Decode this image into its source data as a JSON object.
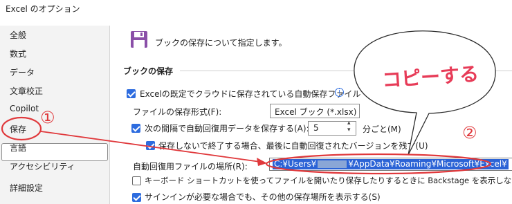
{
  "window": {
    "title": "Excel のオプション"
  },
  "sidebar": {
    "items": [
      {
        "label": "全般"
      },
      {
        "label": "数式"
      },
      {
        "label": "データ"
      },
      {
        "label": "文章校正"
      },
      {
        "label": "Copilot"
      },
      {
        "label": "保存"
      },
      {
        "label": "言語"
      },
      {
        "label": "アクセシビリティ"
      },
      {
        "label": "詳細設定"
      }
    ],
    "selected_index": 5
  },
  "main": {
    "header": "ブックの保存について指定します。",
    "section_title": "ブックの保存",
    "autosave_default": {
      "label": "Excelの既定でクラウドに保存されている自動保存ファイル",
      "checked": true
    },
    "format_label": "ファイルの保存形式(F):",
    "format_value": "Excel ブック (*.xlsx)",
    "autorecover": {
      "label": "次の間隔で自動回復用データを保存する(A):",
      "checked": true
    },
    "interval_value": "5",
    "interval_unit": "分ごと(M)",
    "keep_last": {
      "label": "保存しないで終了する場合、最後に自動回復されたバージョンを残す(U)",
      "checked": true
    },
    "location_label": "自動回復用ファイルの場所(R):",
    "location_value_a": "C:¥Users¥",
    "location_value_b": "¥AppData¥Roaming¥Microsoft¥Excel¥",
    "keyboard_shortcut": {
      "label": "キーボード ショートカットを使ってファイルを開いたり保存したりするときに Backstage を表示しない(S)",
      "checked": false
    },
    "other_locations": {
      "label": "サインインが必要な場合でも、その他の保存場所を表示する(S)",
      "checked": true
    }
  },
  "annotations": {
    "bubble_text": "コピーする",
    "marker_1": "①",
    "marker_2": "②"
  },
  "colors": {
    "accent": "#2d6cdf",
    "annotation": "#e0393c",
    "selection": "#2b63d6"
  }
}
